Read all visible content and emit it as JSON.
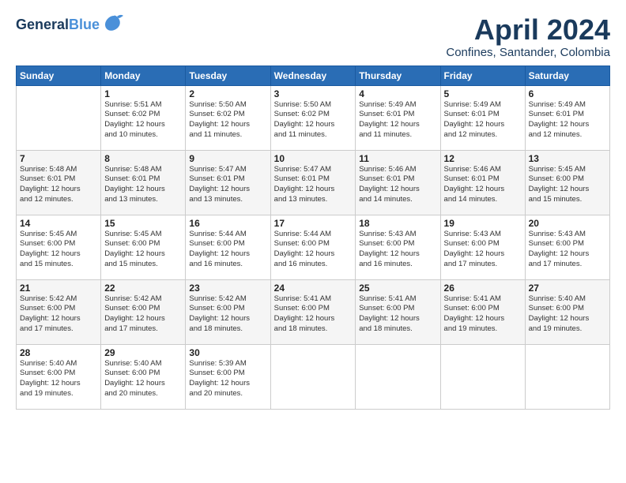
{
  "logo": {
    "line1": "General",
    "line2": "Blue",
    "bird": "🐦"
  },
  "title": "April 2024",
  "location": "Confines, Santander, Colombia",
  "weekdays": [
    "Sunday",
    "Monday",
    "Tuesday",
    "Wednesday",
    "Thursday",
    "Friday",
    "Saturday"
  ],
  "weeks": [
    [
      {
        "day": "",
        "info": ""
      },
      {
        "day": "1",
        "info": "Sunrise: 5:51 AM\nSunset: 6:02 PM\nDaylight: 12 hours\nand 10 minutes."
      },
      {
        "day": "2",
        "info": "Sunrise: 5:50 AM\nSunset: 6:02 PM\nDaylight: 12 hours\nand 11 minutes."
      },
      {
        "day": "3",
        "info": "Sunrise: 5:50 AM\nSunset: 6:02 PM\nDaylight: 12 hours\nand 11 minutes."
      },
      {
        "day": "4",
        "info": "Sunrise: 5:49 AM\nSunset: 6:01 PM\nDaylight: 12 hours\nand 11 minutes."
      },
      {
        "day": "5",
        "info": "Sunrise: 5:49 AM\nSunset: 6:01 PM\nDaylight: 12 hours\nand 12 minutes."
      },
      {
        "day": "6",
        "info": "Sunrise: 5:49 AM\nSunset: 6:01 PM\nDaylight: 12 hours\nand 12 minutes."
      }
    ],
    [
      {
        "day": "7",
        "info": "Sunrise: 5:48 AM\nSunset: 6:01 PM\nDaylight: 12 hours\nand 12 minutes."
      },
      {
        "day": "8",
        "info": "Sunrise: 5:48 AM\nSunset: 6:01 PM\nDaylight: 12 hours\nand 13 minutes."
      },
      {
        "day": "9",
        "info": "Sunrise: 5:47 AM\nSunset: 6:01 PM\nDaylight: 12 hours\nand 13 minutes."
      },
      {
        "day": "10",
        "info": "Sunrise: 5:47 AM\nSunset: 6:01 PM\nDaylight: 12 hours\nand 13 minutes."
      },
      {
        "day": "11",
        "info": "Sunrise: 5:46 AM\nSunset: 6:01 PM\nDaylight: 12 hours\nand 14 minutes."
      },
      {
        "day": "12",
        "info": "Sunrise: 5:46 AM\nSunset: 6:01 PM\nDaylight: 12 hours\nand 14 minutes."
      },
      {
        "day": "13",
        "info": "Sunrise: 5:45 AM\nSunset: 6:00 PM\nDaylight: 12 hours\nand 15 minutes."
      }
    ],
    [
      {
        "day": "14",
        "info": "Sunrise: 5:45 AM\nSunset: 6:00 PM\nDaylight: 12 hours\nand 15 minutes."
      },
      {
        "day": "15",
        "info": "Sunrise: 5:45 AM\nSunset: 6:00 PM\nDaylight: 12 hours\nand 15 minutes."
      },
      {
        "day": "16",
        "info": "Sunrise: 5:44 AM\nSunset: 6:00 PM\nDaylight: 12 hours\nand 16 minutes."
      },
      {
        "day": "17",
        "info": "Sunrise: 5:44 AM\nSunset: 6:00 PM\nDaylight: 12 hours\nand 16 minutes."
      },
      {
        "day": "18",
        "info": "Sunrise: 5:43 AM\nSunset: 6:00 PM\nDaylight: 12 hours\nand 16 minutes."
      },
      {
        "day": "19",
        "info": "Sunrise: 5:43 AM\nSunset: 6:00 PM\nDaylight: 12 hours\nand 17 minutes."
      },
      {
        "day": "20",
        "info": "Sunrise: 5:43 AM\nSunset: 6:00 PM\nDaylight: 12 hours\nand 17 minutes."
      }
    ],
    [
      {
        "day": "21",
        "info": "Sunrise: 5:42 AM\nSunset: 6:00 PM\nDaylight: 12 hours\nand 17 minutes."
      },
      {
        "day": "22",
        "info": "Sunrise: 5:42 AM\nSunset: 6:00 PM\nDaylight: 12 hours\nand 17 minutes."
      },
      {
        "day": "23",
        "info": "Sunrise: 5:42 AM\nSunset: 6:00 PM\nDaylight: 12 hours\nand 18 minutes."
      },
      {
        "day": "24",
        "info": "Sunrise: 5:41 AM\nSunset: 6:00 PM\nDaylight: 12 hours\nand 18 minutes."
      },
      {
        "day": "25",
        "info": "Sunrise: 5:41 AM\nSunset: 6:00 PM\nDaylight: 12 hours\nand 18 minutes."
      },
      {
        "day": "26",
        "info": "Sunrise: 5:41 AM\nSunset: 6:00 PM\nDaylight: 12 hours\nand 19 minutes."
      },
      {
        "day": "27",
        "info": "Sunrise: 5:40 AM\nSunset: 6:00 PM\nDaylight: 12 hours\nand 19 minutes."
      }
    ],
    [
      {
        "day": "28",
        "info": "Sunrise: 5:40 AM\nSunset: 6:00 PM\nDaylight: 12 hours\nand 19 minutes."
      },
      {
        "day": "29",
        "info": "Sunrise: 5:40 AM\nSunset: 6:00 PM\nDaylight: 12 hours\nand 20 minutes."
      },
      {
        "day": "30",
        "info": "Sunrise: 5:39 AM\nSunset: 6:00 PM\nDaylight: 12 hours\nand 20 minutes."
      },
      {
        "day": "",
        "info": ""
      },
      {
        "day": "",
        "info": ""
      },
      {
        "day": "",
        "info": ""
      },
      {
        "day": "",
        "info": ""
      }
    ]
  ]
}
